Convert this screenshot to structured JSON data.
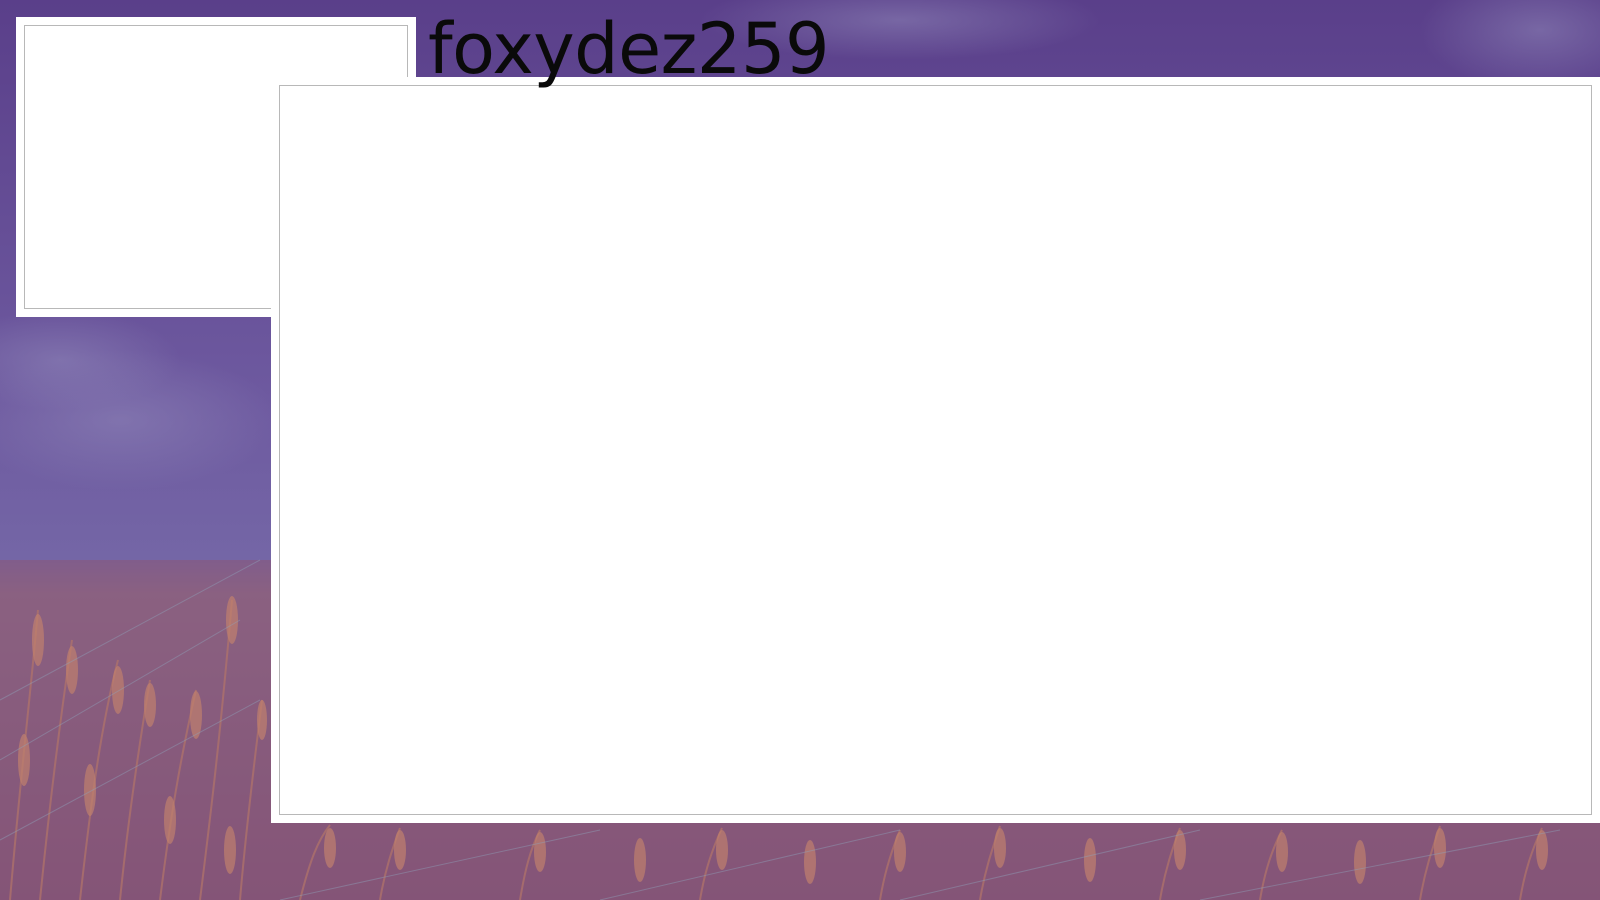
{
  "overlay": {
    "username": "foxydez259",
    "background": {
      "description": "wheat-field",
      "sky_color": "#5f4a8e",
      "field_color": "#8a5a7a",
      "tint_color": "#6b4fa0"
    },
    "webcam_frame_label": "",
    "game_frame_label": ""
  }
}
